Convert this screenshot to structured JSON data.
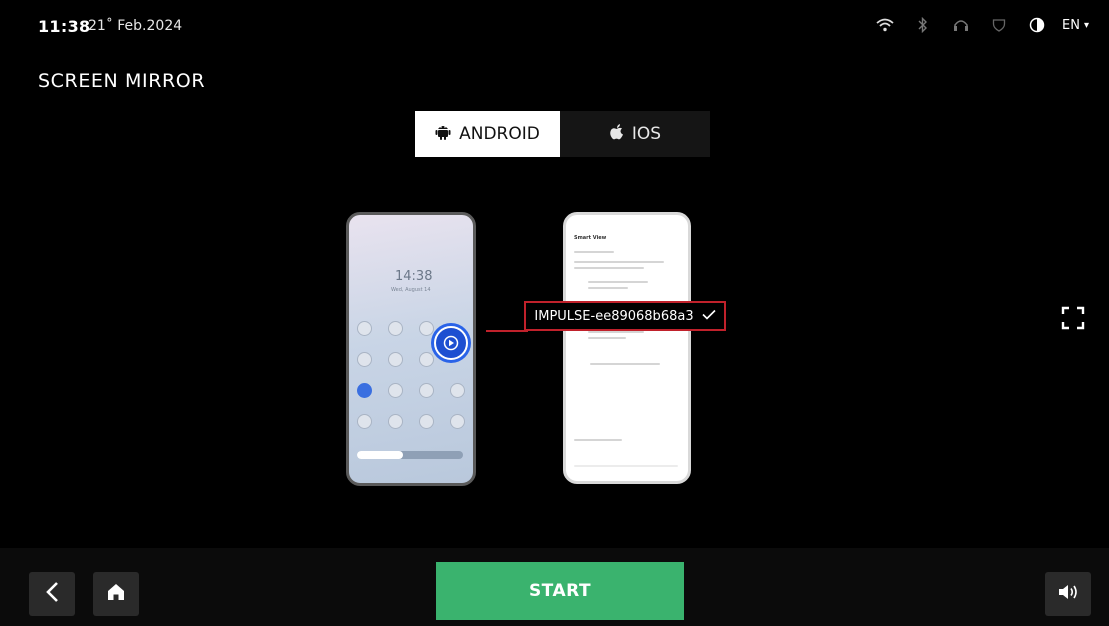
{
  "status": {
    "time": "11:38",
    "date": "21˚ Feb.2024",
    "icons": [
      "wifi-icon",
      "bluetooth-icon",
      "headset-icon",
      "shield-icon",
      "contrast-icon"
    ],
    "language": "EN",
    "language_caret": "▾"
  },
  "page": {
    "title": "SCREEN MIRROR"
  },
  "tabs": [
    {
      "label": "ANDROID",
      "icon": "android-icon",
      "active": true
    },
    {
      "label": "IOS",
      "icon": "apple-icon",
      "active": false
    }
  ],
  "illustration": {
    "phone_time": "14:38",
    "phone_date": "Wed, August 14",
    "smart_view_title": "Smart View",
    "device_name": "IMPULSE-ee89068b68a3"
  },
  "actions": {
    "start_label": "START"
  },
  "colors": {
    "accent_green": "#3ab36e",
    "highlight_red": "#c0212b",
    "cast_blue": "#1d4fd1"
  }
}
